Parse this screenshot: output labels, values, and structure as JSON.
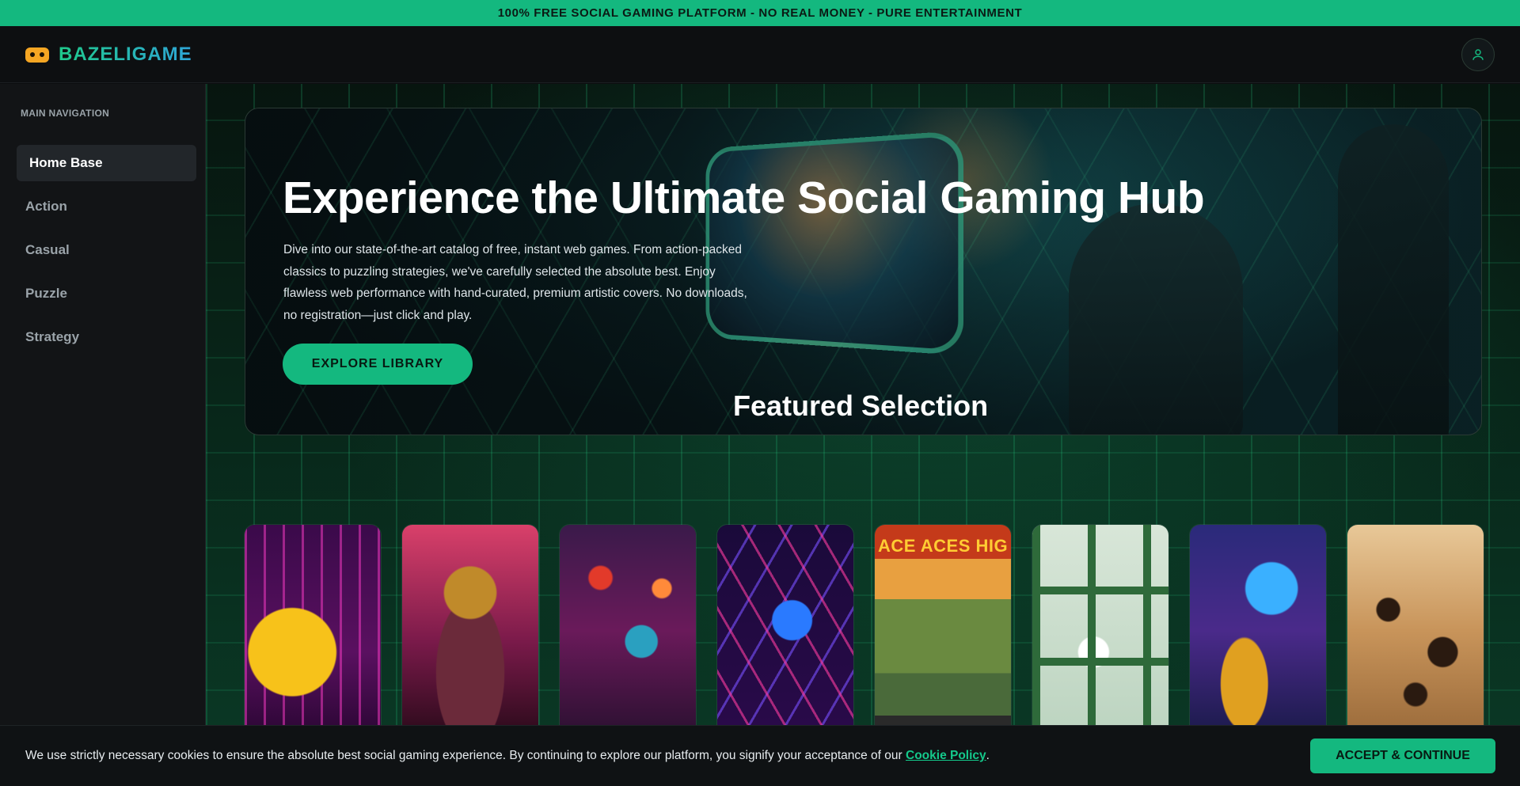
{
  "announcement": "100% FREE SOCIAL GAMING PLATFORM - NO REAL MONEY - PURE ENTERTAINMENT",
  "header": {
    "brand": "BAZELIGAME",
    "logo_icon": "gamepad-icon",
    "user_icon": "user-icon"
  },
  "sidebar": {
    "title": "MAIN NAVIGATION",
    "items": [
      {
        "label": "Home Base",
        "active": true
      },
      {
        "label": "Action",
        "active": false
      },
      {
        "label": "Casual",
        "active": false
      },
      {
        "label": "Puzzle",
        "active": false
      },
      {
        "label": "Strategy",
        "active": false
      }
    ]
  },
  "hero": {
    "title": "Experience the Ultimate Social Gaming Hub",
    "description": "Dive into our state-of-the-art catalog of free, instant web games. From action-packed classics to puzzling strategies, we've carefully selected the absolute best. Enjoy flawless web performance with hand-curated, premium artistic covers. No downloads, no registration—just click and play.",
    "button": "EXPLORE LIBRARY"
  },
  "featured": {
    "title": "Featured Selection",
    "cards": [
      {
        "label": "",
        "theme": "yellow-arcade"
      },
      {
        "label": "",
        "theme": "spartan-warrior"
      },
      {
        "label": "",
        "theme": "floating-cubes"
      },
      {
        "label": "",
        "theme": "neon-hexagons"
      },
      {
        "label": "ACE ACES HIG",
        "theme": "warplanes"
      },
      {
        "label": "",
        "theme": "pipes-birds"
      },
      {
        "label": "",
        "theme": "genie-lamp"
      },
      {
        "label": "",
        "theme": "wood-puzzle"
      }
    ]
  },
  "cookie": {
    "text": "We use strictly necessary cookies to ensure the absolute best social gaming experience. By continuing to explore our platform, you signify your acceptance of our",
    "link": "Cookie Policy",
    "trailing": ".",
    "button": "ACCEPT & CONTINUE"
  },
  "colors": {
    "accent": "#14b87f",
    "sidebar_bg": "#121416",
    "header_bg": "#0d0f11"
  }
}
